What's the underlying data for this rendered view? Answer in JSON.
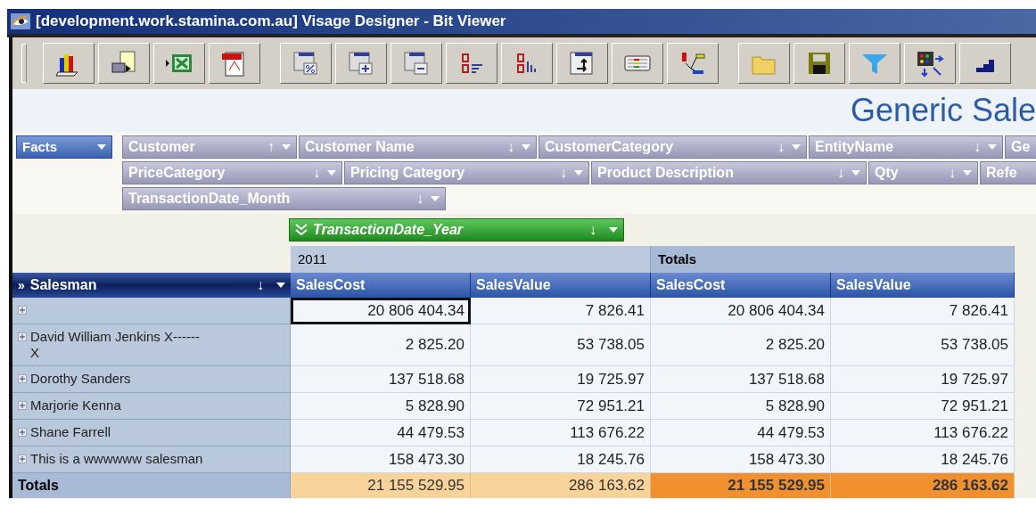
{
  "window": {
    "title": "[development.work.stamina.com.au] Visage Designer - Bit Viewer"
  },
  "toolbar": {
    "groups": [
      {
        "buttons": [
          {
            "kind": "chart"
          },
          {
            "kind": "export"
          },
          {
            "kind": "excel"
          },
          {
            "kind": "pdf"
          }
        ]
      },
      {
        "buttons": [
          {
            "kind": "percent"
          },
          {
            "kind": "add"
          },
          {
            "kind": "remove"
          },
          {
            "kind": "sort-digits"
          },
          {
            "kind": "sort-bars"
          },
          {
            "kind": "swap"
          },
          {
            "kind": "grid"
          },
          {
            "kind": "hierarchy"
          }
        ]
      },
      {
        "buttons": [
          {
            "kind": "folder"
          },
          {
            "kind": "save"
          },
          {
            "kind": "filter"
          },
          {
            "kind": "matrix"
          },
          {
            "kind": "stairs"
          }
        ]
      }
    ]
  },
  "report_title": "Generic Sale",
  "facts_button": {
    "label": "Facts"
  },
  "field_rows": [
    [
      {
        "label": "Customer",
        "sort": "↑"
      },
      {
        "label": "Customer Name",
        "sort": "↓"
      },
      {
        "label": "CustomerCategory",
        "sort": "↓"
      },
      {
        "label": "EntityName",
        "sort": "↓"
      },
      {
        "label": "Ge"
      }
    ],
    [
      {
        "label": "PriceCategory",
        "sort": "↓"
      },
      {
        "label": "Pricing Category",
        "sort": "↓"
      },
      {
        "label": "Product Description",
        "sort": "↓"
      },
      {
        "label": "Qty",
        "sort": "↓"
      },
      {
        "label": "Refe"
      }
    ],
    [
      {
        "label": "TransactionDate_Month",
        "sort": "↓"
      }
    ]
  ],
  "column_field": {
    "label": "TransactionDate_Year",
    "sort": "↓"
  },
  "table": {
    "groups": [
      "2011",
      "Totals"
    ],
    "row_field": {
      "icon": "»",
      "label": "Salesman",
      "sort": "↓"
    },
    "columns": [
      "SalesCost",
      "SalesValue",
      "SalesCost",
      "SalesValue"
    ],
    "rows": [
      {
        "label": "",
        "cells": [
          {
            "text": "20 806 404.34",
            "selected": true
          },
          {
            "text": "7 826.41",
            "selected": false
          },
          {
            "text": "20 806 404.34",
            "selected": false
          },
          {
            "text": "7 826.41",
            "selected": false
          }
        ]
      },
      {
        "label": "David William Jenkins X------X",
        "cells": [
          {
            "text": "2 825.20",
            "selected": false
          },
          {
            "text": "53 738.05",
            "selected": false
          },
          {
            "text": "2 825.20",
            "selected": false
          },
          {
            "text": "53 738.05",
            "selected": false
          }
        ]
      },
      {
        "label": "Dorothy Sanders",
        "cells": [
          {
            "text": "137 518.68",
            "selected": false
          },
          {
            "text": "19 725.97",
            "selected": false
          },
          {
            "text": "137 518.68",
            "selected": false
          },
          {
            "text": "19 725.97",
            "selected": false
          }
        ]
      },
      {
        "label": "Marjorie Kenna",
        "cells": [
          {
            "text": "5 828.90",
            "selected": false
          },
          {
            "text": "72 951.21",
            "selected": false
          },
          {
            "text": "5 828.90",
            "selected": false
          },
          {
            "text": "72 951.21",
            "selected": false
          }
        ]
      },
      {
        "label": "Shane Farrell",
        "cells": [
          {
            "text": "44 479.53",
            "selected": false
          },
          {
            "text": "113 676.22",
            "selected": false
          },
          {
            "text": "44 479.53",
            "selected": false
          },
          {
            "text": "113 676.22",
            "selected": false
          }
        ]
      },
      {
        "label": "This is a wwwwww salesman",
        "cells": [
          {
            "text": "158 473.30",
            "selected": false
          },
          {
            "text": "18 245.76",
            "selected": false
          },
          {
            "text": "158 473.30",
            "selected": false
          },
          {
            "text": "18 245.76",
            "selected": false
          }
        ]
      }
    ],
    "totals": {
      "label": "Totals",
      "cells": [
        "21 155 529.95",
        "286 163.62",
        "21 155 529.95",
        "286 163.62"
      ]
    }
  }
}
